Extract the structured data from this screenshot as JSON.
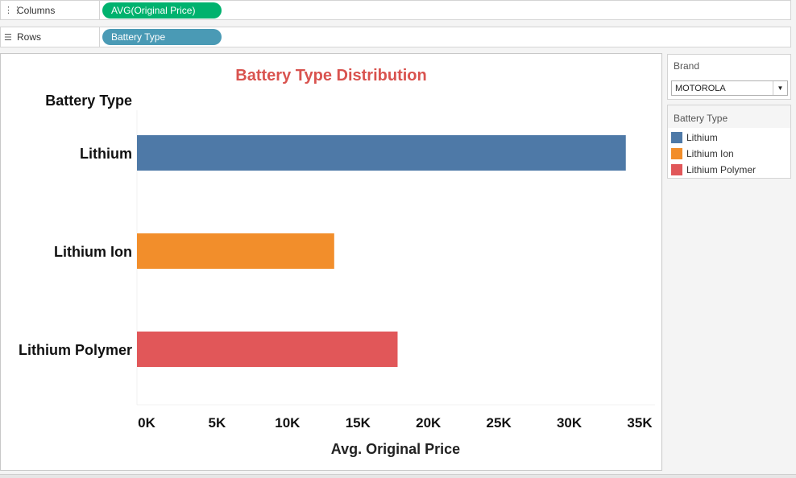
{
  "shelves": {
    "columns": {
      "label": "Columns",
      "icon": "columns-icon",
      "pill": "AVG(Original Price)",
      "pill_color": "#00b26e"
    },
    "rows": {
      "label": "Rows",
      "icon": "rows-icon",
      "pill": "Battery Type",
      "pill_color": "#4a9ab5"
    }
  },
  "filters": {
    "brand": {
      "title": "Brand",
      "selected": "MOTOROLA"
    }
  },
  "legend": {
    "title": "Battery Type",
    "items": [
      {
        "label": "Lithium",
        "color": "#4e79a7"
      },
      {
        "label": "Lithium Ion",
        "color": "#f28e2b"
      },
      {
        "label": "Lithium Polymer",
        "color": "#e15759"
      }
    ]
  },
  "chart_data": {
    "type": "bar",
    "orientation": "horizontal",
    "title": "Battery Type Distribution",
    "title_color": "#d9534f",
    "row_header": "Battery Type",
    "xlabel": "Avg. Original Price",
    "ylabel": "",
    "categories": [
      "Lithium",
      "Lithium Ion",
      "Lithium Polymer"
    ],
    "values": [
      34700,
      14000,
      18500
    ],
    "colors": [
      "#4e79a7",
      "#f28e2b",
      "#e15759"
    ],
    "xlim": [
      0,
      35000
    ],
    "x_ticks": [
      0,
      5000,
      10000,
      15000,
      20000,
      25000,
      30000,
      35000
    ],
    "x_tick_labels": [
      "0K",
      "5K",
      "10K",
      "15K",
      "20K",
      "25K",
      "30K",
      "35K"
    ],
    "grid": false
  }
}
